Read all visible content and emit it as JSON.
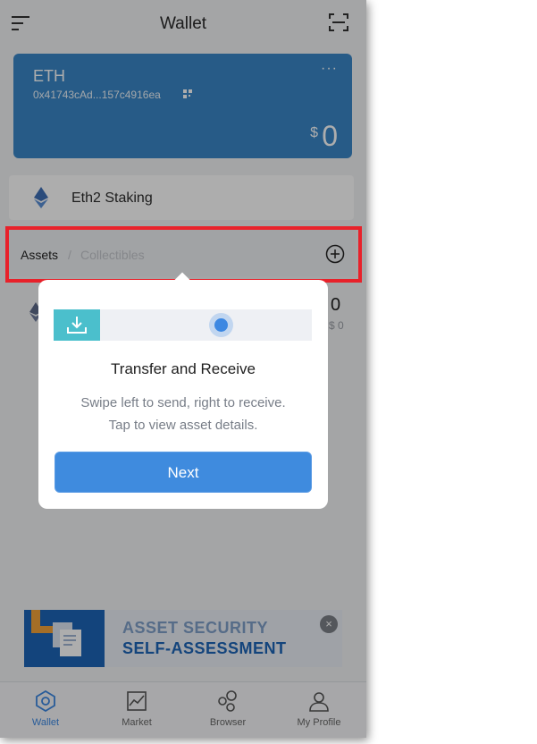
{
  "header": {
    "title": "Wallet",
    "menu_icon": "menu-icon",
    "scan_icon": "scan-icon"
  },
  "wallet_card": {
    "coin": "ETH",
    "address": "0x41743cAd...157c4916ea",
    "more_icon": "ellipsis-icon",
    "currency_symbol": "$",
    "balance": "0",
    "color": "#3a87c8"
  },
  "staking": {
    "label": "Eth2 Staking"
  },
  "assets_bar": {
    "tab_assets": "Assets",
    "separator": "/",
    "tab_collectibles": "Collectibles",
    "add_icon": "plus-circle-icon"
  },
  "asset_row": {
    "amount": "0",
    "fiat": "$ 0"
  },
  "popup": {
    "title": "Transfer and Receive",
    "line1": "Swipe left to send, right to receive.",
    "line2": "Tap to view asset details.",
    "next_label": "Next"
  },
  "banner": {
    "line1": "ASSET SECURITY",
    "line2": "SELF-ASSESSMENT",
    "close_label": "×"
  },
  "tabbar": {
    "items": [
      {
        "label": "Wallet",
        "icon": "wallet-icon",
        "active": true
      },
      {
        "label": "Market",
        "icon": "chart-icon",
        "active": false
      },
      {
        "label": "Browser",
        "icon": "browser-icon",
        "active": false
      },
      {
        "label": "My Profile",
        "icon": "profile-icon",
        "active": false
      }
    ]
  },
  "colors": {
    "accent": "#3b87e2",
    "highlight": "#e8212a",
    "card": "#3a87c8"
  }
}
